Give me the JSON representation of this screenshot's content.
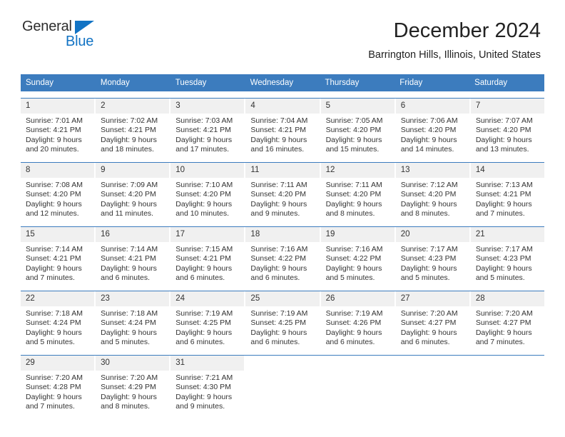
{
  "brand": {
    "name_part1": "General",
    "name_part2": "Blue",
    "triangle_color": "#1273c4"
  },
  "header": {
    "title": "December 2024",
    "location": "Barrington Hills, Illinois, United States"
  },
  "calendar": {
    "header_bg": "#3c7cbe",
    "weekdays": [
      "Sunday",
      "Monday",
      "Tuesday",
      "Wednesday",
      "Thursday",
      "Friday",
      "Saturday"
    ],
    "weeks": [
      [
        {
          "day": "1",
          "sunrise": "Sunrise: 7:01 AM",
          "sunset": "Sunset: 4:21 PM",
          "daylight1": "Daylight: 9 hours",
          "daylight2": "and 20 minutes."
        },
        {
          "day": "2",
          "sunrise": "Sunrise: 7:02 AM",
          "sunset": "Sunset: 4:21 PM",
          "daylight1": "Daylight: 9 hours",
          "daylight2": "and 18 minutes."
        },
        {
          "day": "3",
          "sunrise": "Sunrise: 7:03 AM",
          "sunset": "Sunset: 4:21 PM",
          "daylight1": "Daylight: 9 hours",
          "daylight2": "and 17 minutes."
        },
        {
          "day": "4",
          "sunrise": "Sunrise: 7:04 AM",
          "sunset": "Sunset: 4:21 PM",
          "daylight1": "Daylight: 9 hours",
          "daylight2": "and 16 minutes."
        },
        {
          "day": "5",
          "sunrise": "Sunrise: 7:05 AM",
          "sunset": "Sunset: 4:20 PM",
          "daylight1": "Daylight: 9 hours",
          "daylight2": "and 15 minutes."
        },
        {
          "day": "6",
          "sunrise": "Sunrise: 7:06 AM",
          "sunset": "Sunset: 4:20 PM",
          "daylight1": "Daylight: 9 hours",
          "daylight2": "and 14 minutes."
        },
        {
          "day": "7",
          "sunrise": "Sunrise: 7:07 AM",
          "sunset": "Sunset: 4:20 PM",
          "daylight1": "Daylight: 9 hours",
          "daylight2": "and 13 minutes."
        }
      ],
      [
        {
          "day": "8",
          "sunrise": "Sunrise: 7:08 AM",
          "sunset": "Sunset: 4:20 PM",
          "daylight1": "Daylight: 9 hours",
          "daylight2": "and 12 minutes."
        },
        {
          "day": "9",
          "sunrise": "Sunrise: 7:09 AM",
          "sunset": "Sunset: 4:20 PM",
          "daylight1": "Daylight: 9 hours",
          "daylight2": "and 11 minutes."
        },
        {
          "day": "10",
          "sunrise": "Sunrise: 7:10 AM",
          "sunset": "Sunset: 4:20 PM",
          "daylight1": "Daylight: 9 hours",
          "daylight2": "and 10 minutes."
        },
        {
          "day": "11",
          "sunrise": "Sunrise: 7:11 AM",
          "sunset": "Sunset: 4:20 PM",
          "daylight1": "Daylight: 9 hours",
          "daylight2": "and 9 minutes."
        },
        {
          "day": "12",
          "sunrise": "Sunrise: 7:11 AM",
          "sunset": "Sunset: 4:20 PM",
          "daylight1": "Daylight: 9 hours",
          "daylight2": "and 8 minutes."
        },
        {
          "day": "13",
          "sunrise": "Sunrise: 7:12 AM",
          "sunset": "Sunset: 4:20 PM",
          "daylight1": "Daylight: 9 hours",
          "daylight2": "and 8 minutes."
        },
        {
          "day": "14",
          "sunrise": "Sunrise: 7:13 AM",
          "sunset": "Sunset: 4:21 PM",
          "daylight1": "Daylight: 9 hours",
          "daylight2": "and 7 minutes."
        }
      ],
      [
        {
          "day": "15",
          "sunrise": "Sunrise: 7:14 AM",
          "sunset": "Sunset: 4:21 PM",
          "daylight1": "Daylight: 9 hours",
          "daylight2": "and 7 minutes."
        },
        {
          "day": "16",
          "sunrise": "Sunrise: 7:14 AM",
          "sunset": "Sunset: 4:21 PM",
          "daylight1": "Daylight: 9 hours",
          "daylight2": "and 6 minutes."
        },
        {
          "day": "17",
          "sunrise": "Sunrise: 7:15 AM",
          "sunset": "Sunset: 4:21 PM",
          "daylight1": "Daylight: 9 hours",
          "daylight2": "and 6 minutes."
        },
        {
          "day": "18",
          "sunrise": "Sunrise: 7:16 AM",
          "sunset": "Sunset: 4:22 PM",
          "daylight1": "Daylight: 9 hours",
          "daylight2": "and 6 minutes."
        },
        {
          "day": "19",
          "sunrise": "Sunrise: 7:16 AM",
          "sunset": "Sunset: 4:22 PM",
          "daylight1": "Daylight: 9 hours",
          "daylight2": "and 5 minutes."
        },
        {
          "day": "20",
          "sunrise": "Sunrise: 7:17 AM",
          "sunset": "Sunset: 4:23 PM",
          "daylight1": "Daylight: 9 hours",
          "daylight2": "and 5 minutes."
        },
        {
          "day": "21",
          "sunrise": "Sunrise: 7:17 AM",
          "sunset": "Sunset: 4:23 PM",
          "daylight1": "Daylight: 9 hours",
          "daylight2": "and 5 minutes."
        }
      ],
      [
        {
          "day": "22",
          "sunrise": "Sunrise: 7:18 AM",
          "sunset": "Sunset: 4:24 PM",
          "daylight1": "Daylight: 9 hours",
          "daylight2": "and 5 minutes."
        },
        {
          "day": "23",
          "sunrise": "Sunrise: 7:18 AM",
          "sunset": "Sunset: 4:24 PM",
          "daylight1": "Daylight: 9 hours",
          "daylight2": "and 5 minutes."
        },
        {
          "day": "24",
          "sunrise": "Sunrise: 7:19 AM",
          "sunset": "Sunset: 4:25 PM",
          "daylight1": "Daylight: 9 hours",
          "daylight2": "and 6 minutes."
        },
        {
          "day": "25",
          "sunrise": "Sunrise: 7:19 AM",
          "sunset": "Sunset: 4:25 PM",
          "daylight1": "Daylight: 9 hours",
          "daylight2": "and 6 minutes."
        },
        {
          "day": "26",
          "sunrise": "Sunrise: 7:19 AM",
          "sunset": "Sunset: 4:26 PM",
          "daylight1": "Daylight: 9 hours",
          "daylight2": "and 6 minutes."
        },
        {
          "day": "27",
          "sunrise": "Sunrise: 7:20 AM",
          "sunset": "Sunset: 4:27 PM",
          "daylight1": "Daylight: 9 hours",
          "daylight2": "and 6 minutes."
        },
        {
          "day": "28",
          "sunrise": "Sunrise: 7:20 AM",
          "sunset": "Sunset: 4:27 PM",
          "daylight1": "Daylight: 9 hours",
          "daylight2": "and 7 minutes."
        }
      ],
      [
        {
          "day": "29",
          "sunrise": "Sunrise: 7:20 AM",
          "sunset": "Sunset: 4:28 PM",
          "daylight1": "Daylight: 9 hours",
          "daylight2": "and 7 minutes."
        },
        {
          "day": "30",
          "sunrise": "Sunrise: 7:20 AM",
          "sunset": "Sunset: 4:29 PM",
          "daylight1": "Daylight: 9 hours",
          "daylight2": "and 8 minutes."
        },
        {
          "day": "31",
          "sunrise": "Sunrise: 7:21 AM",
          "sunset": "Sunset: 4:30 PM",
          "daylight1": "Daylight: 9 hours",
          "daylight2": "and 9 minutes."
        },
        {
          "day": "",
          "sunrise": "",
          "sunset": "",
          "daylight1": "",
          "daylight2": ""
        },
        {
          "day": "",
          "sunrise": "",
          "sunset": "",
          "daylight1": "",
          "daylight2": ""
        },
        {
          "day": "",
          "sunrise": "",
          "sunset": "",
          "daylight1": "",
          "daylight2": ""
        },
        {
          "day": "",
          "sunrise": "",
          "sunset": "",
          "daylight1": "",
          "daylight2": ""
        }
      ]
    ]
  }
}
